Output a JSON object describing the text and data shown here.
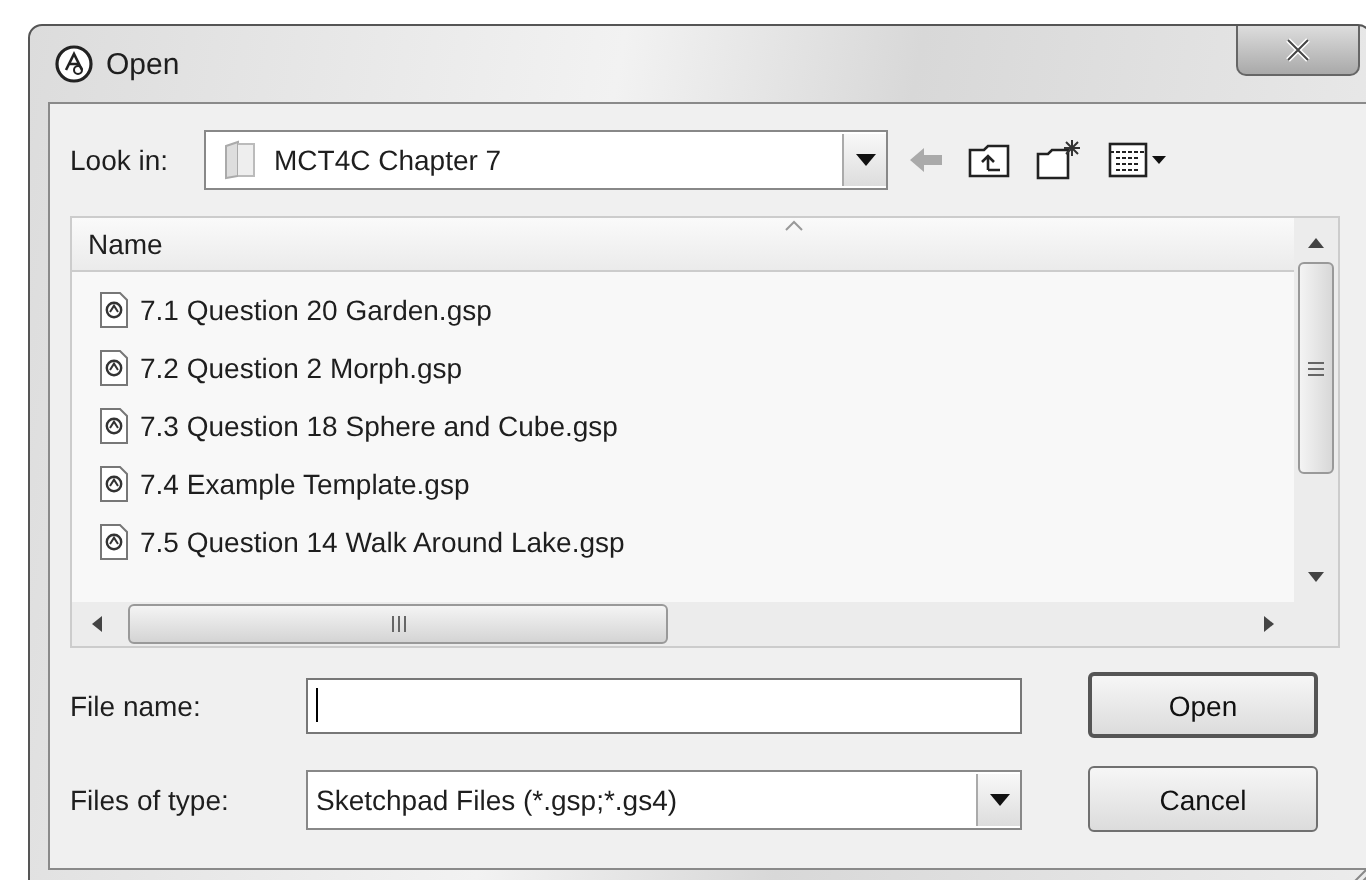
{
  "window": {
    "title": "Open"
  },
  "look_in": {
    "label": "Look in:",
    "value": "MCT4C Chapter 7"
  },
  "file_list": {
    "columns": [
      {
        "label": "Name"
      }
    ],
    "files": [
      {
        "name": "7.1 Question 20 Garden.gsp",
        "selected": false
      },
      {
        "name": "7.2 Question 2 Morph.gsp",
        "selected": false
      },
      {
        "name": "7.3 Question 18 Sphere and Cube.gsp",
        "selected": false
      },
      {
        "name": "7.4 Example Template.gsp",
        "selected": false
      },
      {
        "name": "7.5 Question 14 Walk Around Lake.gsp",
        "selected": false
      }
    ]
  },
  "file_name": {
    "label": "File name:"
  },
  "files_of_type": {
    "label": "Files of type:",
    "value": "Sketchpad Files (*.gsp;*.gs4)"
  },
  "buttons": [
    {
      "label": "Open",
      "default": true
    },
    {
      "label": "Cancel",
      "default": false
    }
  ]
}
